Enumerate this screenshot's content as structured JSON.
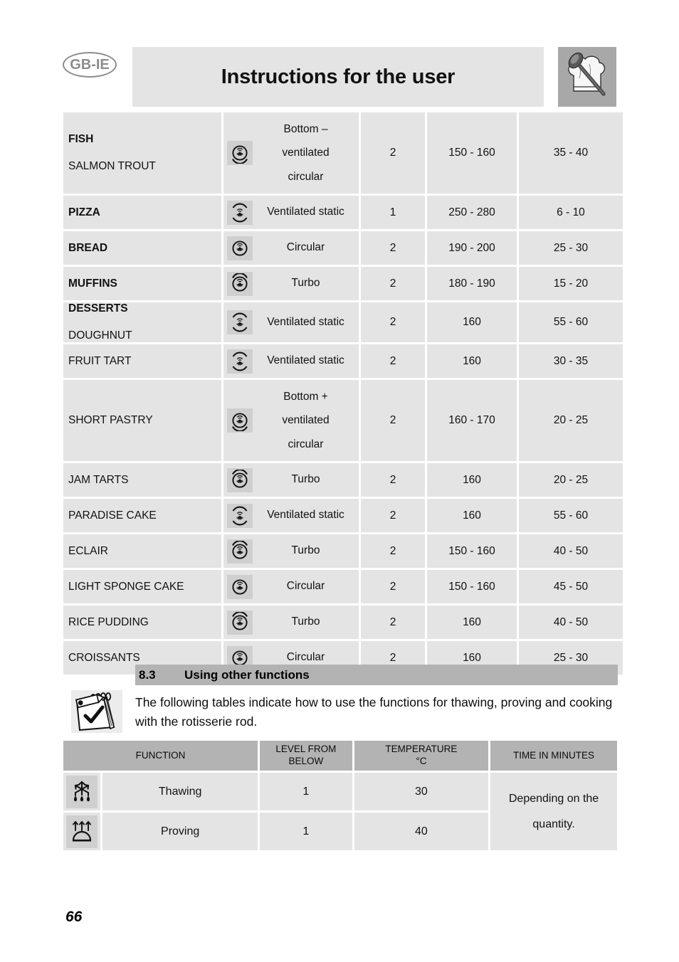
{
  "header": {
    "locale_badge": "GB-IE",
    "title": "Instructions for the user",
    "chef_icon_name": "chef-hat-spoon-icon"
  },
  "cooking_table": {
    "rows": [
      {
        "category": "FISH",
        "food": "SALMON TROUT",
        "function_icon": "bottom-ventilated-circular-icon",
        "function": "Bottom – ventilated circular",
        "function_lines": [
          "Bottom –",
          "ventilated",
          "circular"
        ],
        "level": "2",
        "temperature": "150 - 160",
        "time": "35 - 40"
      },
      {
        "category": "PIZZA",
        "food": "",
        "function_icon": "ventilated-static-icon",
        "function": "Ventilated static",
        "function_lines": [
          "Ventilated static"
        ],
        "level": "1",
        "temperature": "250 - 280",
        "time": "6 - 10"
      },
      {
        "category": "BREAD",
        "food": "",
        "function_icon": "circular-icon",
        "function": "Circular",
        "function_lines": [
          "Circular"
        ],
        "level": "2",
        "temperature": "190 - 200",
        "time": "25 - 30"
      },
      {
        "category": "MUFFINS",
        "food": "",
        "function_icon": "turbo-icon",
        "function": "Turbo",
        "function_lines": [
          "Turbo"
        ],
        "level": "2",
        "temperature": "180 - 190",
        "time": "15 - 20"
      },
      {
        "category": "DESSERTS",
        "food": "DOUGHNUT",
        "function_icon": "ventilated-static-icon",
        "function": "Ventilated static",
        "function_lines": [
          "Ventilated static"
        ],
        "level": "2",
        "temperature": "160",
        "time": "55 - 60"
      },
      {
        "category": "",
        "food": "FRUIT TART",
        "function_icon": "ventilated-static-icon",
        "function": "Ventilated static",
        "function_lines": [
          "Ventilated static"
        ],
        "level": "2",
        "temperature": "160",
        "time": "30 - 35"
      },
      {
        "category": "",
        "food": "SHORT PASTRY",
        "function_icon": "bottom-ventilated-circular-icon",
        "function": "Bottom + ventilated circular",
        "function_lines": [
          "Bottom +",
          "ventilated",
          "circular"
        ],
        "level": "2",
        "temperature": "160 - 170",
        "time": "20 - 25"
      },
      {
        "category": "",
        "food": "JAM TARTS",
        "function_icon": "turbo-icon",
        "function": "Turbo",
        "function_lines": [
          "Turbo"
        ],
        "level": "2",
        "temperature": "160",
        "time": "20 - 25"
      },
      {
        "category": "",
        "food": "PARADISE CAKE",
        "function_icon": "ventilated-static-icon",
        "function": "Ventilated static",
        "function_lines": [
          "Ventilated static"
        ],
        "level": "2",
        "temperature": "160",
        "time": "55 - 60"
      },
      {
        "category": "",
        "food": "ECLAIR",
        "function_icon": "turbo-icon",
        "function": "Turbo",
        "function_lines": [
          "Turbo"
        ],
        "level": "2",
        "temperature": "150 - 160",
        "time": "40 - 50"
      },
      {
        "category": "",
        "food": "LIGHT SPONGE CAKE",
        "function_icon": "circular-icon",
        "function": "Circular",
        "function_lines": [
          "Circular"
        ],
        "level": "2",
        "temperature": "150 - 160",
        "time": "45 - 50"
      },
      {
        "category": "",
        "food": "RICE PUDDING",
        "function_icon": "turbo-icon",
        "function": "Turbo",
        "function_lines": [
          "Turbo"
        ],
        "level": "2",
        "temperature": "160",
        "time": "40 - 50"
      },
      {
        "category": "",
        "food": "CROISSANTS",
        "function_icon": "circular-icon",
        "function": "Circular",
        "function_lines": [
          "Circular"
        ],
        "level": "2",
        "temperature": "160",
        "time": "25 - 30"
      }
    ]
  },
  "section": {
    "number": "8.3",
    "title": "Using other functions",
    "note_icon": "notepad-pencil-check-icon",
    "note_text": "The following tables indicate how to use the functions for thawing, proving and cooking with the rotisserie rod."
  },
  "functions_table": {
    "headers": {
      "function": "FUNCTION",
      "level": "LEVEL FROM BELOW",
      "level_line1": "LEVEL FROM",
      "level_line2": "BELOW",
      "temperature": "TEMPERATURE °C",
      "temperature_line1": "TEMPERATURE",
      "temperature_line2": "°C",
      "time": "TIME IN MINUTES"
    },
    "rows": [
      {
        "icon": "thawing-snowflake-icon",
        "name": "Thawing",
        "level": "1",
        "temperature": "30"
      },
      {
        "icon": "proving-dome-arrows-icon",
        "name": "Proving",
        "level": "1",
        "temperature": "40"
      }
    ],
    "time_value_line1": "Depending on the",
    "time_value_line2": "quantity.",
    "time_value": "Depending on the quantity."
  },
  "footer": {
    "page_number": "66"
  },
  "colors": {
    "cell_bg": "#e4e4e4",
    "header_bg": "#b3b3b3",
    "icon_bg": "#cfcfcf",
    "chef_bg": "#a8a8a8"
  }
}
